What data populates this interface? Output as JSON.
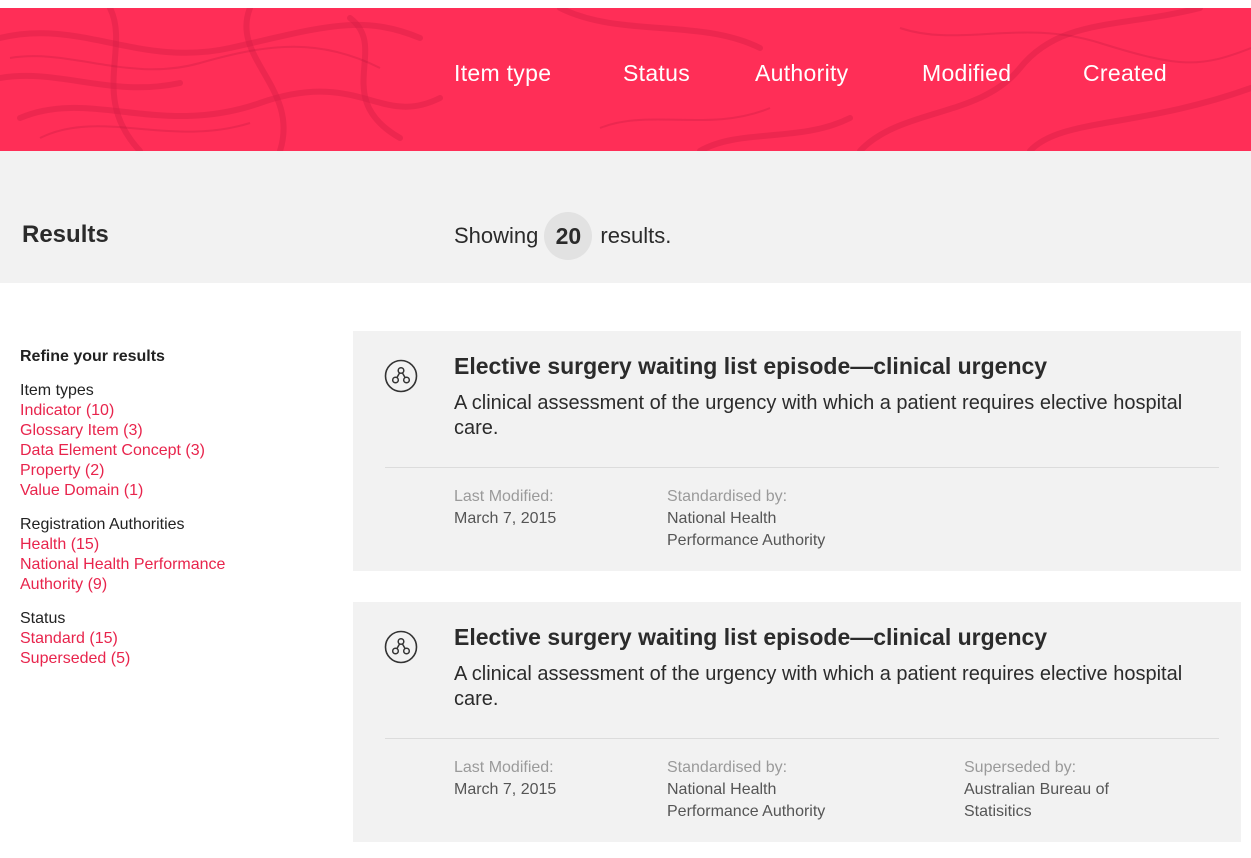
{
  "header": {
    "nav": [
      "Item type",
      "Status",
      "Authority",
      "Modified",
      "Created"
    ]
  },
  "results_bar": {
    "title": "Results",
    "showing_prefix": "Showing",
    "count": "20",
    "showing_suffix": "results."
  },
  "sidebar": {
    "heading": "Refine your results",
    "groups": [
      {
        "title": "Item types",
        "items": [
          "Indicator (10)",
          "Glossary Item (3)",
          "Data Element Concept (3)",
          "Property (2)",
          "Value Domain (1)"
        ]
      },
      {
        "title": "Registration Authorities",
        "items": [
          "Health (15)",
          "National Health Performance Authority (9)"
        ]
      },
      {
        "title": "Status",
        "items": [
          "Standard (15)",
          "Superseded (5)"
        ]
      }
    ]
  },
  "results": [
    {
      "icon": "node-graph-icon",
      "title": "Elective surgery waiting list episode—clinical urgency",
      "description": "A clinical assessment of the urgency with which a patient requires elective hospital care.",
      "last_modified_label": "Last Modified:",
      "last_modified": "March 7, 2015",
      "standardised_label": "Standardised by:",
      "standardised_by": "National Health Performance Authority"
    },
    {
      "icon": "node-graph-icon",
      "title": "Elective surgery waiting list episode—clinical urgency",
      "description": "A clinical assessment of the urgency with which a patient requires elective hospital care.",
      "last_modified_label": "Last Modified:",
      "last_modified": "March 7, 2015",
      "standardised_label": "Standardised by:",
      "standardised_by": "National Health Performance Authority",
      "superseded_label": "Superseded by:",
      "superseded_by": "Australian Bureau of Statisitics"
    }
  ],
  "colors": {
    "header_bg": "#ff2e57",
    "link": "#e8244c",
    "panel_bg": "#f2f2f2"
  }
}
